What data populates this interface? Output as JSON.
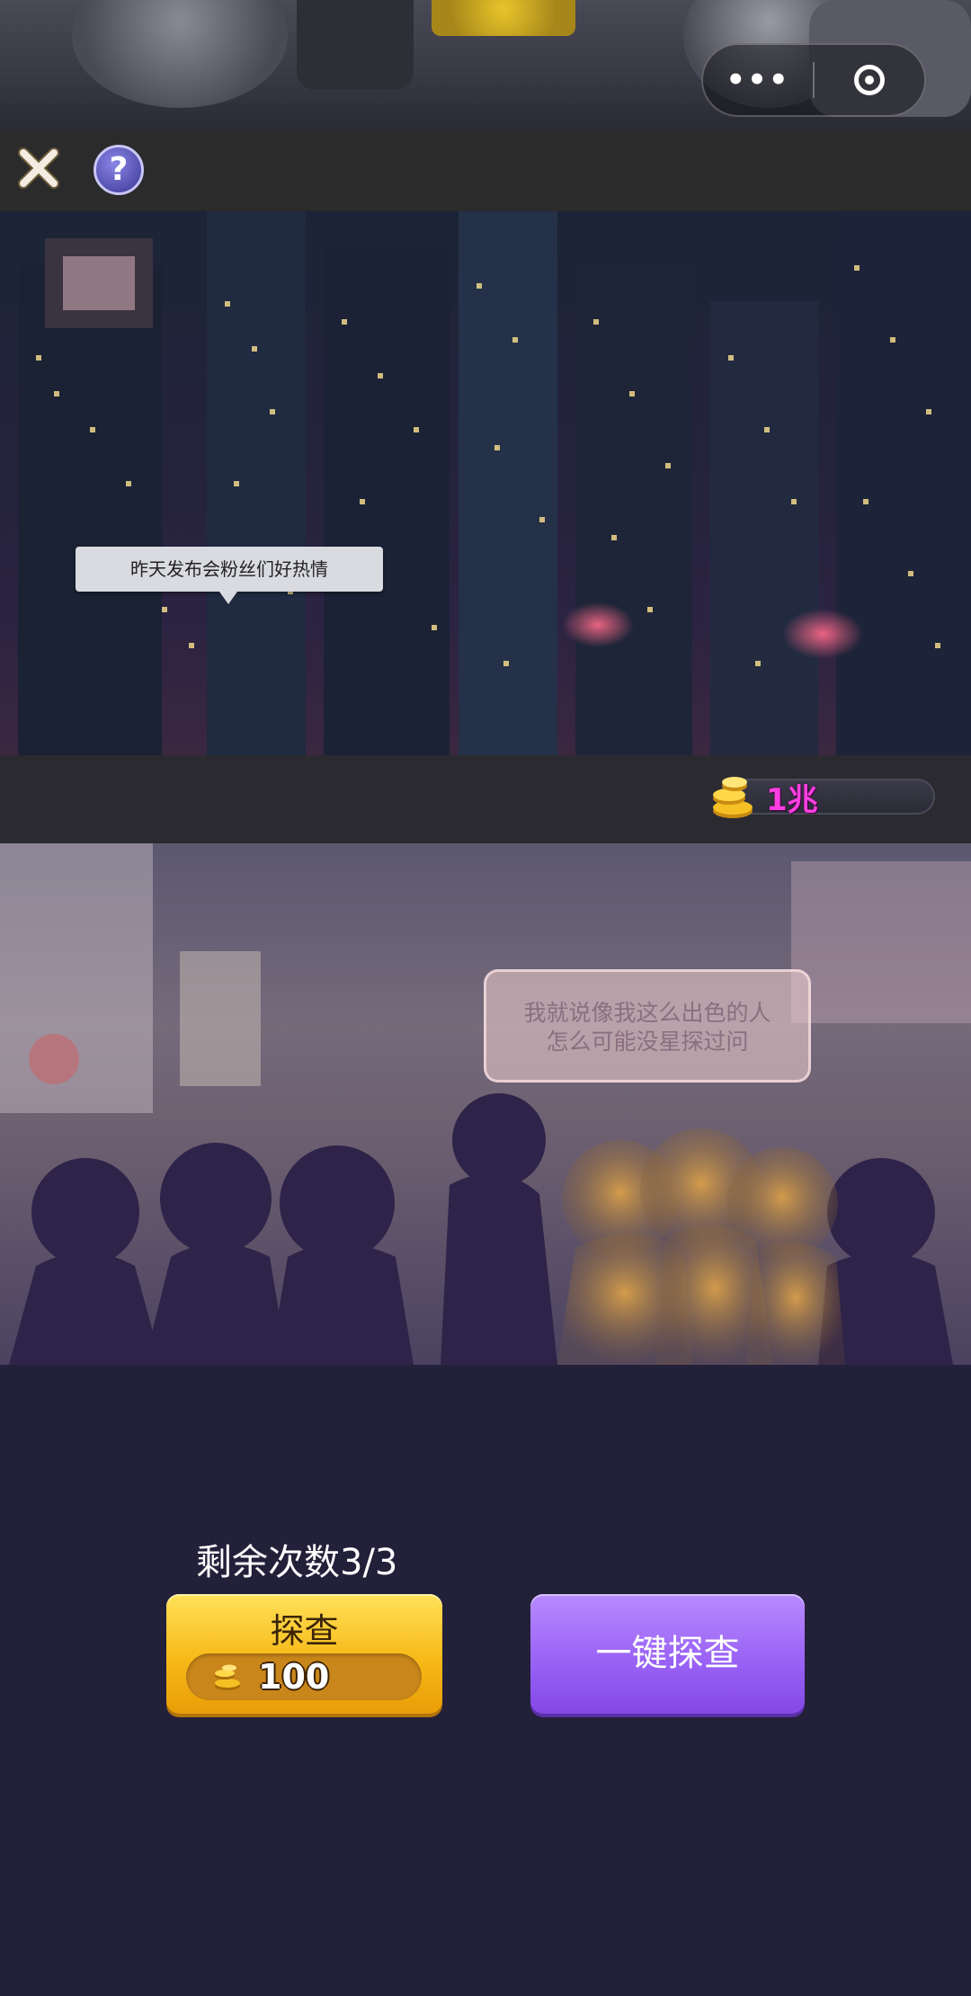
{
  "capsule": {
    "menu_label": "•••",
    "icons": [
      "more-dots-icon",
      "target-icon"
    ]
  },
  "toolbar": {
    "icons": [
      "close-icon",
      "help-icon"
    ],
    "help_label": "?"
  },
  "scene_city": {
    "speech": "昨天发布会粉丝们好热情"
  },
  "currency": {
    "icon": "gold-coin-stack-icon",
    "value": "1兆",
    "color": "#ff3fe0"
  },
  "scene_fans": {
    "speech_lines": [
      "我就说像我这么出色的人",
      "怎么可能没星探过问"
    ]
  },
  "actions": {
    "remaining_text": "剩余次数3/3",
    "probe": {
      "label": "探查",
      "cost_icon": "gold-coin-icon",
      "cost": "100",
      "color": "#f7b917"
    },
    "one_click": {
      "label": "一键探查",
      "color": "#9a63f5"
    }
  },
  "colors": {
    "background": "#23203a",
    "toolbar": "#2b2b2b"
  }
}
